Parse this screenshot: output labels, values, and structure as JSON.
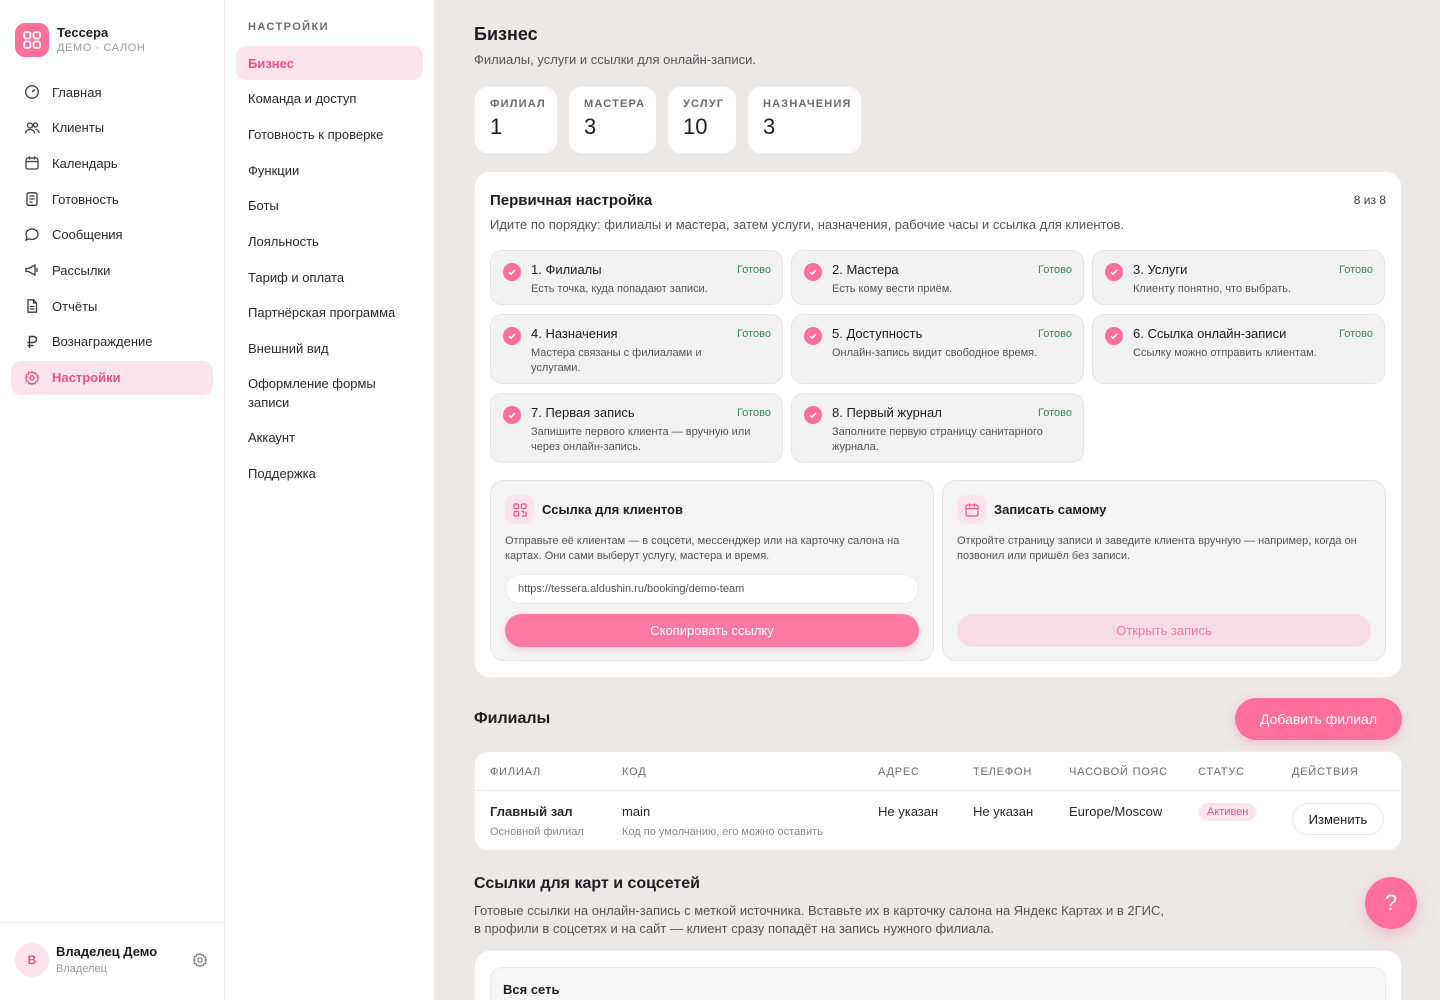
{
  "brand": {
    "name": "Тессера",
    "sub": "ДЕМО · САЛОН"
  },
  "nav": [
    {
      "label": "Главная",
      "icon": "dashboard-icon"
    },
    {
      "label": "Клиенты",
      "icon": "users-icon"
    },
    {
      "label": "Календарь",
      "icon": "calendar-icon"
    },
    {
      "label": "Готовность",
      "icon": "checklist-icon"
    },
    {
      "label": "Сообщения",
      "icon": "chat-icon"
    },
    {
      "label": "Рассылки",
      "icon": "megaphone-icon"
    },
    {
      "label": "Отчёты",
      "icon": "report-icon"
    },
    {
      "label": "Вознаграждение",
      "icon": "ruble-icon"
    },
    {
      "label": "Настройки",
      "icon": "gear-icon",
      "active": true
    }
  ],
  "user": {
    "initial": "В",
    "name": "Владелец Демо",
    "role": "Владелец"
  },
  "subnav": {
    "title": "НАСТРОЙКИ",
    "items": [
      {
        "label": "Бизнес",
        "active": true
      },
      {
        "label": "Команда и доступ"
      },
      {
        "label": "Готовность к проверке"
      },
      {
        "label": "Функции"
      },
      {
        "label": "Боты"
      },
      {
        "label": "Лояльность"
      },
      {
        "label": "Тариф и оплата"
      },
      {
        "label": "Партнёрская программа"
      },
      {
        "label": "Внешний вид"
      },
      {
        "label": "Оформление формы записи"
      },
      {
        "label": "Аккаунт"
      },
      {
        "label": "Поддержка"
      }
    ]
  },
  "page": {
    "title": "Бизнес",
    "subtitle": "Филиалы, услуги и ссылки для онлайн-записи."
  },
  "stats": [
    {
      "label": "ФИЛИАЛ",
      "value": "1"
    },
    {
      "label": "МАСТЕРА",
      "value": "3"
    },
    {
      "label": "УСЛУГ",
      "value": "10"
    },
    {
      "label": "НАЗНАЧЕНИЯ",
      "value": "3"
    }
  ],
  "setup": {
    "title": "Первичная настройка",
    "count": "8 из 8",
    "subtitle": "Идите по порядку: филиалы и мастера, затем услуги, назначения, рабочие часы и ссылка для клиентов.",
    "steps": [
      {
        "title": "1. Филиалы",
        "status": "Готово",
        "desc": "Есть точка, куда попадают записи."
      },
      {
        "title": "2. Мастера",
        "status": "Готово",
        "desc": "Есть кому вести приём."
      },
      {
        "title": "3. Услуги",
        "status": "Готово",
        "desc": "Клиенту понятно, что выбрать."
      },
      {
        "title": "4. Назначения",
        "status": "Готово",
        "desc": "Мастера связаны с филиалами и услугами."
      },
      {
        "title": "5. Доступность",
        "status": "Готово",
        "desc": "Онлайн-запись видит свободное время."
      },
      {
        "title": "6. Ссылка онлайн-записи",
        "status": "Готово",
        "desc": "Ссылку можно отправить клиентам."
      },
      {
        "title": "7. Первая запись",
        "status": "Готово",
        "desc": "Запишите первого клиента — вручную или через онлайн-запись."
      },
      {
        "title": "8. Первый журнал",
        "status": "Готово",
        "desc": "Заполните первую страницу санитарного журнала."
      }
    ],
    "client_link": {
      "title": "Ссылка для клиентов",
      "text": "Отправьте её клиентам — в соцсети, мессенджер или на карточку салона на картах. Они сами выберут услугу, мастера и время.",
      "url": "https://tessera.aldushin.ru/booking/demo-team",
      "button": "Скопировать ссылку"
    },
    "self_book": {
      "title": "Записать самому",
      "text": "Откройте страницу записи и заведите клиента вручную — например, когда он позвонил или пришёл без записи.",
      "button": "Открыть запись"
    }
  },
  "branches": {
    "title": "Филиалы",
    "add_button": "Добавить филиал",
    "columns": [
      "ФИЛИАЛ",
      "КОД",
      "АДРЕС",
      "ТЕЛЕФОН",
      "ЧАСОВОЙ ПОЯС",
      "СТАТУС",
      "ДЕЙСТВИЯ"
    ],
    "rows": [
      {
        "name": "Главный зал",
        "name_sub": "Основной филиал",
        "code": "main",
        "code_sub": "Код по умолчанию, его можно оставить",
        "address": "Не указан",
        "phone": "Не указан",
        "timezone": "Europe/Moscow",
        "status": "Активен",
        "action": "Изменить"
      }
    ]
  },
  "links": {
    "title": "Ссылки для карт и соцсетей",
    "subtitle": "Готовые ссылки на онлайн-запись с меткой источника. Вставьте их в карточку салона на Яндекс Картах и в 2ГИС, в профили в соцсетях и на сайт — клиент сразу попадёт на запись нужного филиала.",
    "group_title": "Вся сеть"
  },
  "help": {
    "label": "?"
  },
  "colors": {
    "accent": "#ff6f9a",
    "accent_soft": "#fde4ec",
    "ok": "#2f8a4f"
  }
}
